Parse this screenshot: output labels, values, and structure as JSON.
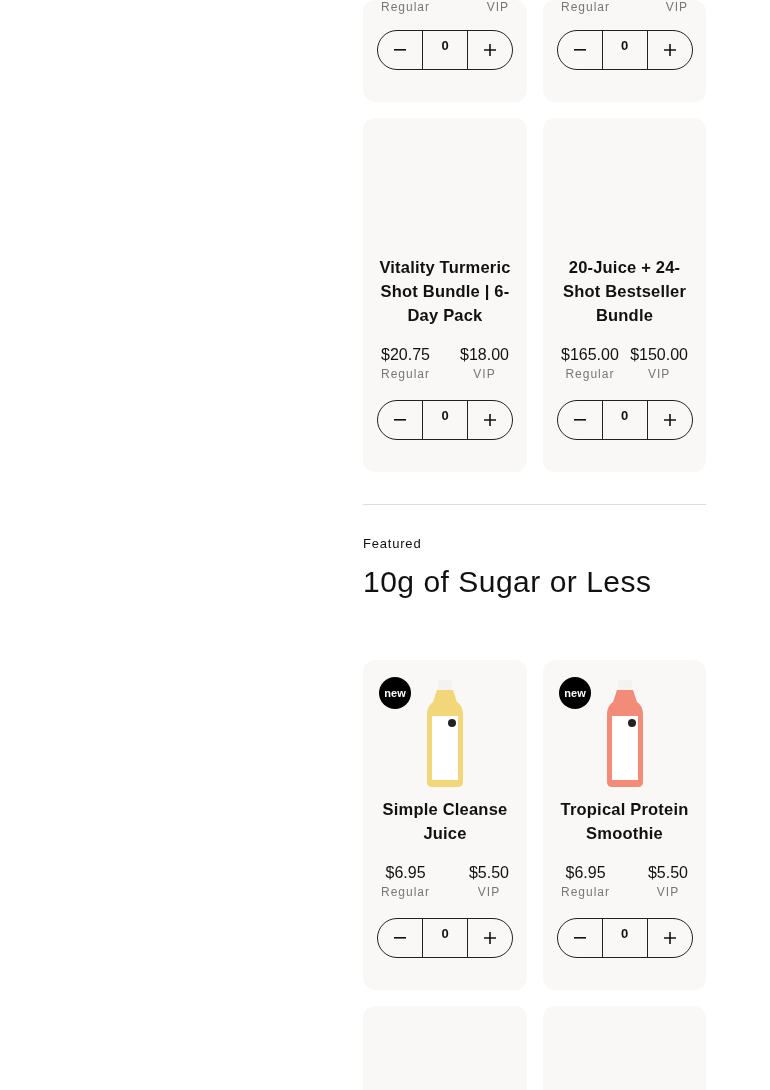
{
  "top_products": [
    {
      "kind": "tail",
      "regular_label": "Regular",
      "vip_label": "VIP",
      "quantity": "0"
    },
    {
      "kind": "tail",
      "regular_label": "Regular",
      "vip_label": "VIP",
      "quantity": "0"
    },
    {
      "kind": "full",
      "title": "Vitality Turmeric Shot Bundle | 6-Day Pack",
      "regular_price": "$20.75",
      "regular_label": "Regular",
      "vip_price": "$18.00",
      "vip_label": "VIP",
      "quantity": "0"
    },
    {
      "kind": "full",
      "title": "20-Juice + 24-Shot Bestseller Bundle",
      "regular_price": "$165.00",
      "regular_label": "Regular",
      "vip_price": "$150.00",
      "vip_label": "VIP",
      "quantity": "0"
    }
  ],
  "featured": {
    "eyebrow": "Featured",
    "heading": "10g of Sugar or Less",
    "products": [
      {
        "kind": "full",
        "badge": "new",
        "color": "#f2d77a",
        "title": "Simple Cleanse Juice",
        "regular_price": "$6.95",
        "regular_label": "Regular",
        "vip_price": "$5.50",
        "vip_label": "VIP",
        "quantity": "0"
      },
      {
        "kind": "full",
        "badge": "new",
        "color": "#f28b78",
        "title": "Tropical Protein Smoothie",
        "regular_price": "$6.95",
        "regular_label": "Regular",
        "vip_price": "$5.50",
        "vip_label": "VIP",
        "quantity": "0"
      },
      {
        "kind": "head"
      },
      {
        "kind": "head"
      }
    ]
  }
}
